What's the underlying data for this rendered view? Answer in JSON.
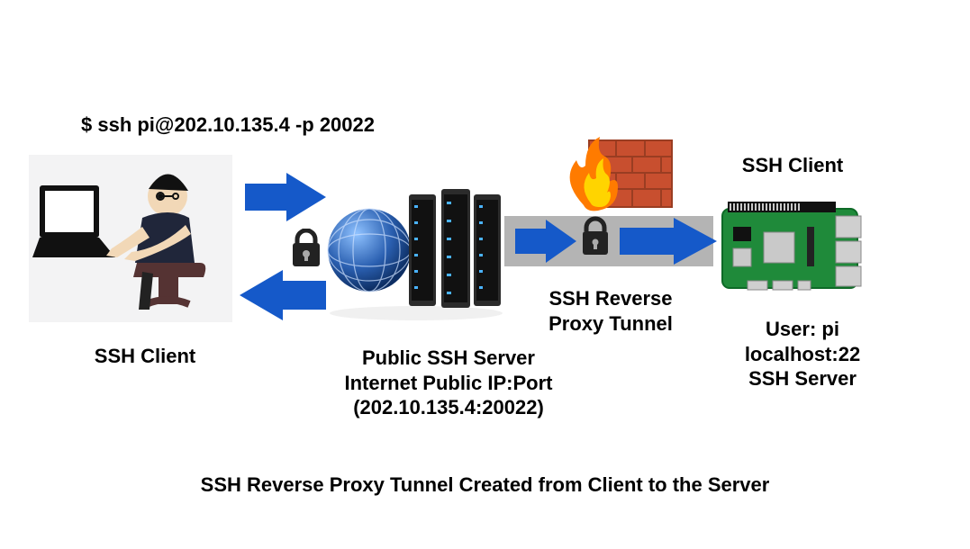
{
  "command": "$ ssh pi@202.10.135.4 -p 20022",
  "ssh_client_left_label": "SSH Client",
  "public_server_label_line1": "Public SSH Server",
  "public_server_label_line2": "Internet Public IP:Port",
  "public_server_label_line3": "(202.10.135.4:20022)",
  "tunnel_label_line1": "SSH Reverse",
  "tunnel_label_line2": "Proxy Tunnel",
  "ssh_client_right_label": "SSH Client",
  "pi_label_line1": "User: pi",
  "pi_label_line2": "localhost:22",
  "pi_label_line3": "SSH Server",
  "caption": "SSH Reverse Proxy Tunnel Created from Client to the Server",
  "colors": {
    "arrow": "#1559c9",
    "brick": "#c84f2f",
    "brick_dark": "#9a3d22",
    "flame_outer": "#ff7b00",
    "flame_inner": "#ffd400",
    "lock": "#222",
    "globe": "#2a5fb0",
    "rack": "#2b2b2b",
    "board": "#1f8a3a",
    "board_dark": "#0e6a27",
    "band": "#b4b4b4"
  }
}
